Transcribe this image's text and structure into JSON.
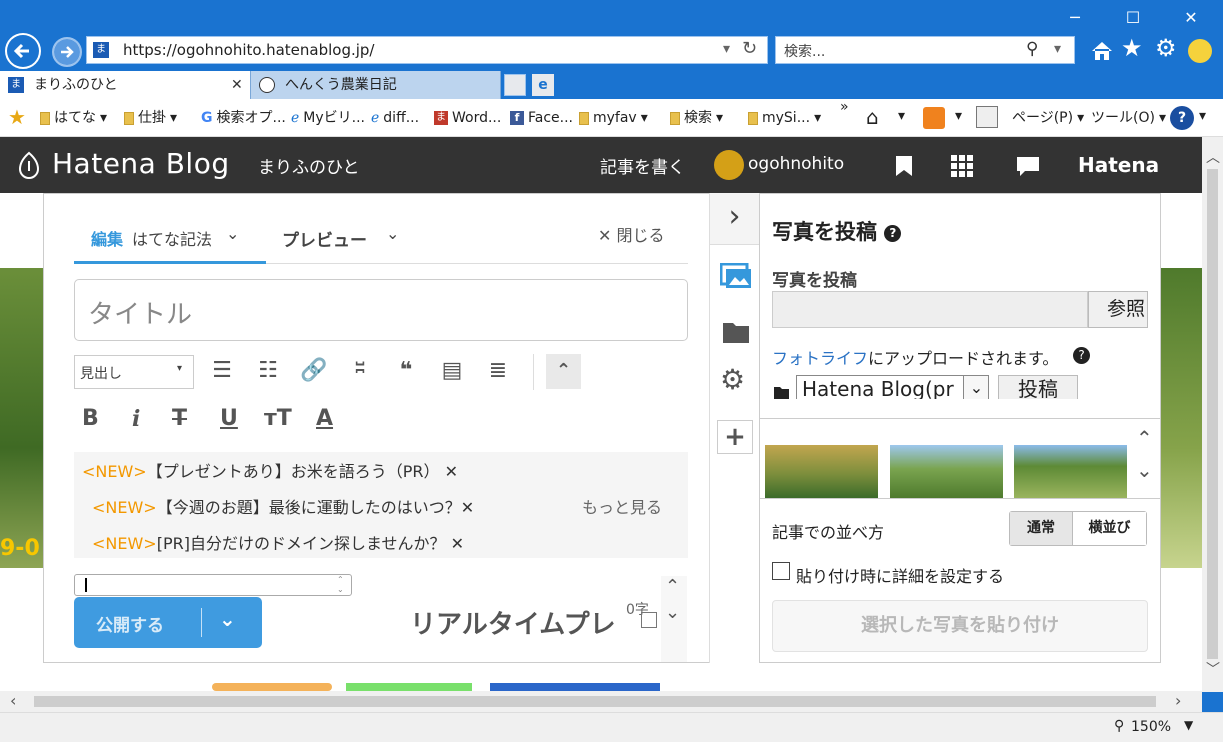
{
  "browser": {
    "window_controls": {
      "minimize": "─",
      "maximize": "☐",
      "close": "✕"
    },
    "url": "https://ogohnohito.hatenablog.jp/",
    "search_placeholder": "検索...",
    "tabs": [
      {
        "label": "まりふのひと",
        "close": "✕"
      },
      {
        "label": "へんくう農業日記"
      }
    ],
    "favorites": [
      {
        "label": "はてな",
        "icon": "folder-icon"
      },
      {
        "label": "仕掛",
        "icon": "folder-icon"
      },
      {
        "label": "検索オプ...",
        "icon": "google-icon"
      },
      {
        "label": "Myビリ...",
        "icon": "ie-page-icon"
      },
      {
        "label": "diff...",
        "icon": "ie-page-icon"
      },
      {
        "label": "Word...",
        "icon": "hatena-icon"
      },
      {
        "label": "Face...",
        "icon": "facebook-icon"
      },
      {
        "label": "myfav",
        "icon": "folder-icon"
      },
      {
        "label": "検索",
        "icon": "folder-icon"
      },
      {
        "label": "mySi...",
        "icon": "folder-icon"
      }
    ],
    "more": "»",
    "page_menu": "ページ(P)",
    "tools_menu": "ツール(O)",
    "zoom": "150%",
    "accent": "#1a73d0"
  },
  "blog": {
    "logo": "Hatena Blog",
    "blog_name": "まりふのひと",
    "write": "記事を書く",
    "user": "ogohnohito",
    "hatena": "Hatena",
    "bar_color": "#333333"
  },
  "editor": {
    "tab_edit": "編集",
    "tab_edit_mode": "はてな記法",
    "tab_preview": "プレビュー",
    "close": "閉じる",
    "title_placeholder": "タイトル",
    "heading_select": "見出し",
    "notifications": [
      {
        "tag": "<NEW>",
        "text": "【プレゼントあり】お米を語ろう（PR）"
      },
      {
        "tag": "<NEW>",
        "text": "【今週のお題】最後に運動したのはいつ？"
      },
      {
        "tag": "<NEW>",
        "text": "[PR]自分だけのドメイン探しませんか？"
      }
    ],
    "more_link": "もっと見る",
    "publish": "公開する",
    "realtime_preview": "リアルタイムプレ",
    "char_count": "0字"
  },
  "photo_panel": {
    "header": "写真を投稿",
    "section_label": "写真を投稿",
    "browse": "参照",
    "fotolife_link": "フォトライフ",
    "upload_note": "にアップロードされます。",
    "folder_select": "Hatena Blog(pr",
    "post_button": "投稿",
    "order_label": "記事での並べ方",
    "order_normal": "通常",
    "order_horizontal": "横並び",
    "paste_detail": "貼り付け時に詳細を設定する",
    "paste_button": "選択した写真を貼り付け"
  },
  "background_text": {
    "date": "9-0"
  }
}
